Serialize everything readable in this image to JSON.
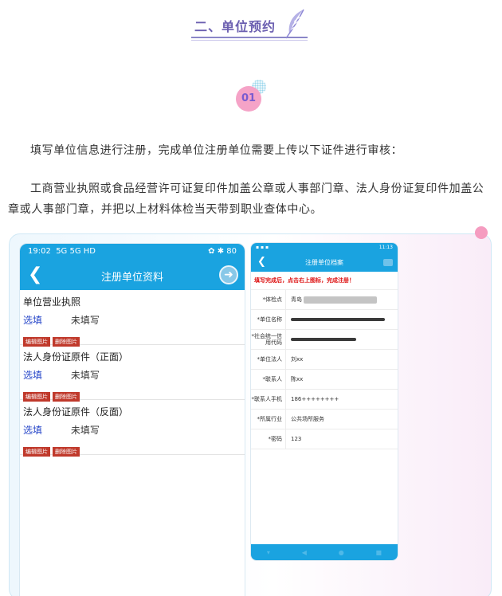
{
  "section": {
    "title": "二、单位预约",
    "icon": "feather-icon"
  },
  "step": {
    "number": "01"
  },
  "paragraphs": {
    "p1": "填写单位信息进行注册，完成单位注册单位需要上传以下证件进行审核：",
    "p2": "工商营业执照或食品经营许可证复印件加盖公章或人事部门章、法人身份证复印件加盖公章或人事部门章，并把以上材料体检当天带到职业查体中心。"
  },
  "colors": {
    "accent": "#1aa3e0",
    "heading": "#6b5fb0",
    "badge": "#f5a3c7",
    "danger": "#c0392b"
  },
  "phone1": {
    "status_time": "19:02",
    "status_signal": "5G 5G HD",
    "status_right": "✿ ✱ 80",
    "title": "注册单位资料",
    "sections": [
      {
        "name": "单位营业执照",
        "pick": "选填",
        "state": "未填写",
        "edit": "编辑图片",
        "delete": "删除图片"
      },
      {
        "name": "法人身份证原件（正面）",
        "pick": "选填",
        "state": "未填写",
        "edit": "编辑图片",
        "delete": "删除图片"
      },
      {
        "name": "法人身份证原件（反面）",
        "pick": "选填",
        "state": "未填写",
        "edit": "编辑图片",
        "delete": "删除图片"
      }
    ]
  },
  "phone2": {
    "status_left": "▪ ▪ ▪",
    "status_right": "11:13",
    "title": "注册单位档案",
    "warning": "填写完成后，点击右上图标，完成注册！",
    "rows": [
      {
        "label": "*体检点",
        "value": "青岛"
      },
      {
        "label": "*单位名称",
        "value": ""
      },
      {
        "label": "*社会统一信用代码",
        "value": ""
      },
      {
        "label": "*单位法人",
        "value": "刘xx"
      },
      {
        "label": "*联系人",
        "value": "陈xx"
      },
      {
        "label": "*联系人手机",
        "value": "186++++++++"
      },
      {
        "label": "*所属行业",
        "value": "公共场所服务"
      },
      {
        "label": "*密码",
        "value": "123"
      }
    ]
  }
}
